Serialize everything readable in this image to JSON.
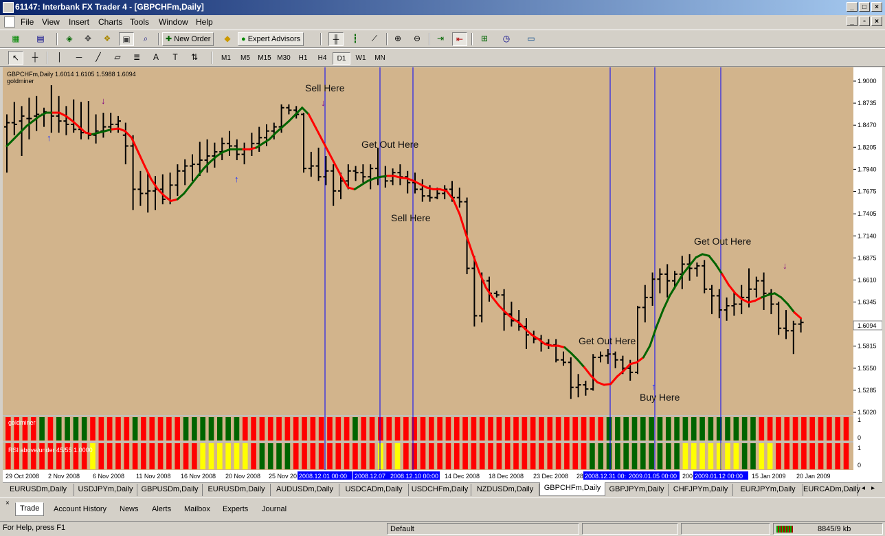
{
  "window": {
    "title": "61147: Interbank FX Trader 4 - [GBPCHFm,Daily]",
    "min": "_",
    "max": "□",
    "close": "×",
    "restore": "▫"
  },
  "menu": [
    "File",
    "View",
    "Insert",
    "Charts",
    "Tools",
    "Window",
    "Help"
  ],
  "toolbar": {
    "new_order": "New Order",
    "expert_advisors": "Expert Advisors"
  },
  "timeframes": [
    "M1",
    "M5",
    "M15",
    "M30",
    "H1",
    "H4",
    "D1",
    "W1",
    "MN"
  ],
  "active_timeframe": "D1",
  "chart": {
    "header": "GBPCHFm,Daily  1.6014 1.6105 1.5988 1.6094",
    "indicator_name": "goldminer",
    "current_price": "1.6094",
    "price_labels": [
      "1.9000",
      "1.8735",
      "1.8470",
      "1.8205",
      "1.7940",
      "1.7675",
      "1.7405",
      "1.7140",
      "1.6875",
      "1.6610",
      "1.6345",
      "1.6094",
      "1.5815",
      "1.5550",
      "1.5285",
      "1.5020"
    ],
    "date_labels": [
      "29 Oct 2008",
      "2 Nov 2008",
      "6 Nov 2008",
      "11 Nov 2008",
      "16 Nov 2008",
      "20 Nov 2008",
      "25 Nov 20",
      "14 Dec 2008",
      "18 Dec 2008",
      "23 Dec 2008",
      "28",
      "200",
      "15 Jan 2009",
      "20 Jan 2009"
    ],
    "vline_labels": [
      "2008.12.01 00:00",
      "2008.12.07",
      "2008.12.10 00:00",
      "2008.12.31 00:",
      "2009.01.05 00:00",
      "2009.01.12 00:00"
    ],
    "annotations": [
      "Sell Here",
      "Get Out Here",
      "Sell Here",
      "Get Out Here",
      "Buy Here",
      "Get Out Here"
    ],
    "sub1": {
      "name": "goldminer",
      "scale_top": "1",
      "scale_bottom": "0"
    },
    "sub2": {
      "name": "RSI above/under 45/55 1.0000",
      "scale_top": "1",
      "scale_bottom": "0"
    },
    "colors": {
      "bg": "#d2b48c",
      "up": "#006400",
      "down": "#ff0000",
      "neutral": "#ffff00",
      "vline": "#0000ff"
    },
    "ohlc": [
      [
        1.845,
        1.86,
        1.79,
        1.85
      ],
      [
        1.85,
        1.875,
        1.835,
        1.848
      ],
      [
        1.852,
        1.87,
        1.81,
        1.858
      ],
      [
        1.855,
        1.88,
        1.83,
        1.855
      ],
      [
        1.858,
        1.882,
        1.84,
        1.86
      ],
      [
        1.86,
        1.868,
        1.845,
        1.863
      ],
      [
        1.862,
        1.895,
        1.838,
        1.858
      ],
      [
        1.858,
        1.882,
        1.838,
        1.852
      ],
      [
        1.852,
        1.87,
        1.835,
        1.848
      ],
      [
        1.848,
        1.878,
        1.838,
        1.842
      ],
      [
        1.842,
        1.875,
        1.83,
        1.838
      ],
      [
        1.838,
        1.876,
        1.83,
        1.835
      ],
      [
        1.835,
        1.86,
        1.825,
        1.84
      ],
      [
        1.84,
        1.862,
        1.832,
        1.845
      ],
      [
        1.845,
        1.862,
        1.838,
        1.848
      ],
      [
        1.848,
        1.858,
        1.838,
        1.852
      ],
      [
        1.835,
        1.85,
        1.8,
        1.822
      ],
      [
        1.822,
        1.835,
        1.745,
        1.77
      ],
      [
        1.77,
        1.792,
        1.75,
        1.765
      ],
      [
        1.765,
        1.79,
        1.742,
        1.768
      ],
      [
        1.768,
        1.786,
        1.745,
        1.77
      ],
      [
        1.77,
        1.788,
        1.752,
        1.758
      ],
      [
        1.758,
        1.79,
        1.752,
        1.775
      ],
      [
        1.775,
        1.8,
        1.762,
        1.792
      ],
      [
        1.792,
        1.806,
        1.775,
        1.798
      ],
      [
        1.798,
        1.812,
        1.78,
        1.8
      ],
      [
        1.8,
        1.827,
        1.786,
        1.805
      ],
      [
        1.805,
        1.83,
        1.79,
        1.81
      ],
      [
        1.81,
        1.826,
        1.796,
        1.815
      ],
      [
        1.815,
        1.832,
        1.805,
        1.825
      ],
      [
        1.825,
        1.84,
        1.81,
        1.822
      ],
      [
        1.822,
        1.83,
        1.805,
        1.812
      ],
      [
        1.812,
        1.826,
        1.8,
        1.818
      ],
      [
        1.818,
        1.838,
        1.81,
        1.825
      ],
      [
        1.825,
        1.845,
        1.815,
        1.832
      ],
      [
        1.832,
        1.848,
        1.822,
        1.84
      ],
      [
        1.84,
        1.85,
        1.83,
        1.845
      ],
      [
        1.845,
        1.872,
        1.838,
        1.868
      ],
      [
        1.868,
        1.872,
        1.86,
        1.865
      ],
      [
        1.865,
        1.87,
        1.855,
        1.86
      ],
      [
        1.86,
        1.862,
        1.79,
        1.795
      ],
      [
        1.795,
        1.815,
        1.785,
        1.798
      ],
      [
        1.798,
        1.82,
        1.78,
        1.785
      ],
      [
        1.785,
        1.81,
        1.775,
        1.792
      ],
      [
        1.792,
        1.8,
        1.75,
        1.768
      ],
      [
        1.768,
        1.79,
        1.758,
        1.78
      ],
      [
        1.78,
        1.8,
        1.77,
        1.792
      ],
      [
        1.792,
        1.798,
        1.78,
        1.79
      ],
      [
        1.79,
        1.8,
        1.778,
        1.785
      ],
      [
        1.785,
        1.8,
        1.77,
        1.795
      ],
      [
        1.795,
        1.82,
        1.775,
        1.785
      ],
      [
        1.785,
        1.798,
        1.772,
        1.78
      ],
      [
        1.78,
        1.795,
        1.775,
        1.79
      ],
      [
        1.79,
        1.8,
        1.775,
        1.785
      ],
      [
        1.785,
        1.792,
        1.765,
        1.778
      ],
      [
        1.778,
        1.79,
        1.765,
        1.77
      ],
      [
        1.77,
        1.782,
        1.755,
        1.762
      ],
      [
        1.762,
        1.775,
        1.755,
        1.76
      ],
      [
        1.76,
        1.772,
        1.758,
        1.765
      ],
      [
        1.765,
        1.775,
        1.758,
        1.77
      ],
      [
        1.77,
        1.78,
        1.755,
        1.76
      ],
      [
        1.76,
        1.772,
        1.748,
        1.755
      ],
      [
        1.755,
        1.76,
        1.668,
        1.675
      ],
      [
        1.675,
        1.69,
        1.605,
        1.618
      ],
      [
        1.618,
        1.67,
        1.61,
        1.66
      ],
      [
        1.66,
        1.665,
        1.635,
        1.645
      ],
      [
        1.645,
        1.648,
        1.64,
        1.643
      ],
      [
        1.643,
        1.65,
        1.6,
        1.62
      ],
      [
        1.62,
        1.635,
        1.605,
        1.612
      ],
      [
        1.612,
        1.625,
        1.6,
        1.605
      ],
      [
        1.605,
        1.615,
        1.578,
        1.595
      ],
      [
        1.595,
        1.6,
        1.585,
        1.59
      ],
      [
        1.59,
        1.595,
        1.575,
        1.585
      ],
      [
        1.585,
        1.59,
        1.578,
        1.583
      ],
      [
        1.583,
        1.59,
        1.562,
        1.565
      ],
      [
        1.565,
        1.575,
        1.558,
        1.562
      ],
      [
        1.562,
        1.568,
        1.518,
        1.532
      ],
      [
        1.532,
        1.548,
        1.52,
        1.535
      ],
      [
        1.535,
        1.54,
        1.522,
        1.53
      ],
      [
        1.53,
        1.572,
        1.528,
        1.568
      ],
      [
        1.568,
        1.575,
        1.562,
        1.57
      ],
      [
        1.57,
        1.578,
        1.56,
        1.572
      ],
      [
        1.572,
        1.575,
        1.555,
        1.565
      ],
      [
        1.565,
        1.57,
        1.548,
        1.555
      ],
      [
        1.555,
        1.565,
        1.54,
        1.55
      ],
      [
        1.55,
        1.63,
        1.548,
        1.628
      ],
      [
        1.628,
        1.655,
        1.61,
        1.64
      ],
      [
        1.64,
        1.67,
        1.63,
        1.662
      ],
      [
        1.662,
        1.675,
        1.645,
        1.668
      ],
      [
        1.668,
        1.68,
        1.64,
        1.66
      ],
      [
        1.66,
        1.672,
        1.65,
        1.668
      ],
      [
        1.668,
        1.69,
        1.65,
        1.68
      ],
      [
        1.68,
        1.692,
        1.66,
        1.675
      ],
      [
        1.675,
        1.682,
        1.665,
        1.678
      ],
      [
        1.678,
        1.685,
        1.645,
        1.65
      ],
      [
        1.65,
        1.655,
        1.62,
        1.642
      ],
      [
        1.642,
        1.65,
        1.615,
        1.625
      ],
      [
        1.625,
        1.64,
        1.612,
        1.63
      ],
      [
        1.63,
        1.648,
        1.618,
        1.632
      ],
      [
        1.632,
        1.655,
        1.62,
        1.64
      ],
      [
        1.64,
        1.675,
        1.628,
        1.65
      ],
      [
        1.65,
        1.665,
        1.64,
        1.66
      ],
      [
        1.66,
        1.67,
        1.625,
        1.645
      ],
      [
        1.645,
        1.65,
        1.62,
        1.632
      ],
      [
        1.632,
        1.635,
        1.595,
        1.603
      ],
      [
        1.603,
        1.625,
        1.59,
        1.6
      ],
      [
        1.6,
        1.612,
        1.572,
        1.608
      ],
      [
        1.608,
        1.615,
        1.598,
        1.61
      ]
    ],
    "ma": [
      1.822,
      1.83,
      1.838,
      1.846,
      1.852,
      1.858,
      1.862,
      1.862,
      1.862,
      1.858,
      1.852,
      1.845,
      1.838,
      1.836,
      1.838,
      1.84,
      1.842,
      1.843,
      1.84,
      1.832,
      1.815,
      1.798,
      1.782,
      1.77,
      1.762,
      1.756,
      1.758,
      1.765,
      1.775,
      1.785,
      1.795,
      1.803,
      1.81,
      1.815,
      1.818,
      1.818,
      1.818,
      1.818,
      1.82,
      1.825,
      1.83,
      1.838,
      1.845,
      1.852,
      1.86,
      1.868,
      1.86,
      1.845,
      1.83,
      1.815,
      1.8,
      1.785,
      1.772,
      1.77,
      1.775,
      1.78,
      1.783,
      1.785,
      1.786,
      1.786,
      1.784,
      1.783,
      1.78,
      1.776,
      1.772,
      1.77,
      1.77,
      1.768,
      1.758,
      1.74,
      1.715,
      1.692,
      1.67,
      1.652,
      1.64,
      1.63,
      1.622,
      1.615,
      1.61,
      1.602,
      1.595,
      1.59,
      1.584,
      1.582,
      1.582,
      1.58,
      1.573,
      1.565,
      1.556,
      1.546,
      1.538,
      1.535,
      1.536,
      1.545,
      1.552,
      1.56,
      1.562,
      1.568,
      1.582,
      1.605,
      1.625,
      1.642,
      1.655,
      1.668,
      1.678,
      1.688,
      1.692,
      1.69,
      1.68,
      1.668,
      1.655,
      1.645,
      1.638,
      1.634,
      1.636,
      1.64,
      1.643,
      1.645,
      1.64,
      1.632,
      1.622,
      1.615
    ],
    "ma_dir": [
      "u",
      "u",
      "u",
      "u",
      "u",
      "u",
      "u",
      "d",
      "d",
      "d",
      "d",
      "d",
      "d",
      "u",
      "u",
      "u",
      "d",
      "d",
      "d",
      "d",
      "d",
      "d",
      "d",
      "d",
      "d",
      "d",
      "u",
      "u",
      "u",
      "u",
      "u",
      "u",
      "u",
      "u",
      "u",
      "u",
      "d",
      "d",
      "u",
      "u",
      "u",
      "u",
      "u",
      "u",
      "u",
      "u",
      "d",
      "d",
      "d",
      "d",
      "d",
      "d",
      "d",
      "u",
      "u",
      "u",
      "u",
      "u",
      "d",
      "d",
      "d",
      "d",
      "d",
      "d",
      "d",
      "d",
      "d",
      "d",
      "d",
      "d",
      "d",
      "d",
      "d",
      "d",
      "d",
      "d",
      "d",
      "d",
      "d",
      "d",
      "d",
      "d",
      "d",
      "d",
      "d",
      "u",
      "u",
      "u",
      "d",
      "d",
      "d",
      "d",
      "d",
      "d",
      "d",
      "d",
      "d",
      "u",
      "u",
      "u",
      "u",
      "u",
      "u",
      "u",
      "u",
      "u",
      "u",
      "u",
      "u",
      "d",
      "d",
      "d",
      "d",
      "d",
      "d",
      "u",
      "u",
      "u",
      "u",
      "u",
      "d",
      "d",
      "d",
      "d"
    ],
    "sub1_colors": [
      "r",
      "r",
      "r",
      "r",
      "g",
      "r",
      "g",
      "g",
      "g",
      "g",
      "r",
      "r",
      "r",
      "r",
      "r",
      "g",
      "r",
      "r",
      "r",
      "r",
      "r",
      "g",
      "g",
      "g",
      "g",
      "g",
      "g",
      "g",
      "r",
      "r",
      "r",
      "r",
      "r",
      "r",
      "r",
      "r",
      "r",
      "r",
      "r",
      "r",
      "r",
      "g",
      "r",
      "r",
      "r",
      "r",
      "r",
      "r",
      "r",
      "r",
      "r",
      "r",
      "r",
      "r",
      "r",
      "r",
      "r",
      "r",
      "r",
      "r",
      "r",
      "r",
      "r",
      "r",
      "r",
      "r",
      "r",
      "r",
      "r",
      "r",
      "r",
      "g",
      "g",
      "g",
      "g",
      "g",
      "g",
      "g",
      "g",
      "g",
      "g",
      "g",
      "g",
      "g",
      "g",
      "g",
      "g",
      "g",
      "g",
      "r",
      "r",
      "r",
      "r",
      "r",
      "r",
      "r",
      "r",
      "r",
      "r",
      "r"
    ],
    "sub2_colors": [
      "r",
      "r",
      "r",
      "r",
      "r",
      "r",
      "r",
      "r",
      "r",
      "r",
      "y",
      "r",
      "r",
      "r",
      "r",
      "r",
      "r",
      "r",
      "r",
      "r",
      "r",
      "r",
      "r",
      "y",
      "y",
      "y",
      "y",
      "y",
      "y",
      "r",
      "g",
      "g",
      "g",
      "g",
      "r",
      "r",
      "r",
      "r",
      "r",
      "r",
      "r",
      "r",
      "r",
      "r",
      "y",
      "r",
      "y",
      "r",
      "r",
      "r",
      "r",
      "r",
      "r",
      "r",
      "r",
      "r",
      "r",
      "r",
      "r",
      "r",
      "r",
      "r",
      "r",
      "r",
      "r",
      "r",
      "r",
      "r",
      "r",
      "g",
      "g",
      "g",
      "g",
      "g",
      "g",
      "g",
      "g",
      "g",
      "g",
      "g",
      "y",
      "y",
      "y",
      "y",
      "y",
      "y",
      "y",
      "g",
      "g",
      "y",
      "y",
      "r",
      "r",
      "r",
      "r",
      "r",
      "r",
      "r",
      "r",
      "r"
    ]
  },
  "symbol_tabs": [
    "EURUSDm,Daily",
    "USDJPYm,Daily",
    "GBPUSDm,Daily",
    "EURUSDm,Daily",
    "AUDUSDm,Daily",
    "USDCADm,Daily",
    "USDCHFm,Daily",
    "NZDUSDm,Daily",
    "GBPCHFm,Daily",
    "GBPJPYm,Daily",
    "CHFJPYm,Daily",
    "EURJPYm,Daily",
    "EURCADm,Daily"
  ],
  "active_symbol_tab": "GBPCHFm,Daily",
  "terminal_tabs": [
    "Trade",
    "Account History",
    "News",
    "Alerts",
    "Mailbox",
    "Experts",
    "Journal"
  ],
  "status": {
    "help": "For Help, press F1",
    "profile": "Default",
    "traffic": "8845/9 kb"
  }
}
